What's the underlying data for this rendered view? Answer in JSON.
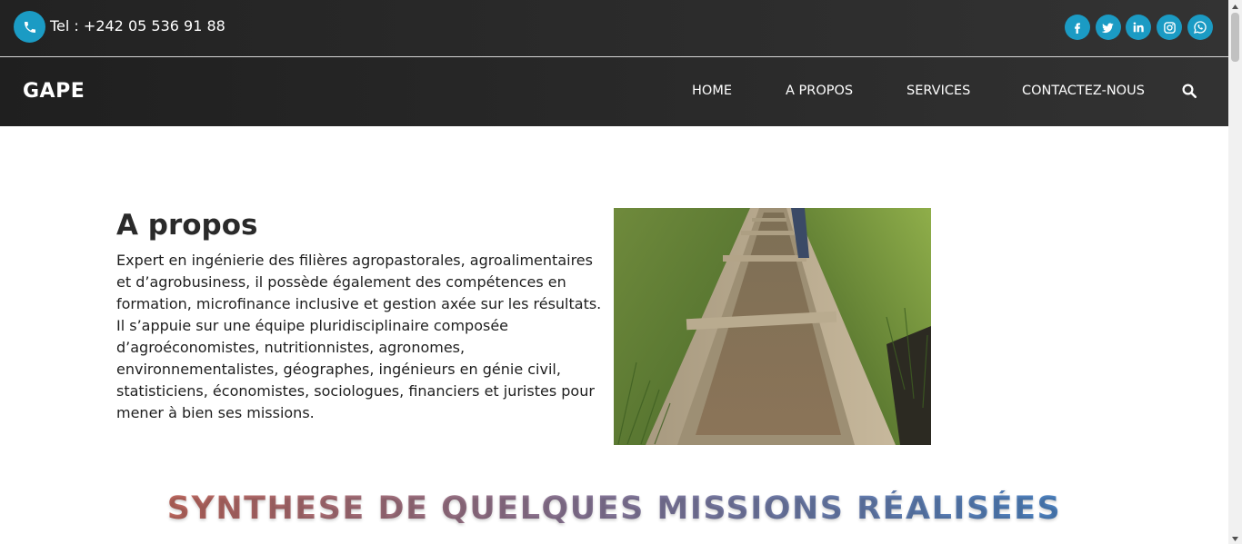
{
  "topbar": {
    "phone_label": "Tel : +242 05 536 91 88",
    "phone_icon": "phone-icon",
    "accent_color": "#1b9bc4",
    "socials": [
      {
        "name": "facebook-icon",
        "glyph": "f"
      },
      {
        "name": "twitter-icon",
        "glyph": "twitter"
      },
      {
        "name": "linkedin-icon",
        "glyph": "in"
      },
      {
        "name": "instagram-icon",
        "glyph": "instagram"
      },
      {
        "name": "whatsapp-icon",
        "glyph": "whatsapp"
      }
    ]
  },
  "navbar": {
    "logo": "GAPE",
    "items": [
      {
        "label": "HOME"
      },
      {
        "label": "A PROPOS"
      },
      {
        "label": "SERVICES"
      },
      {
        "label": "CONTACTEZ-NOUS"
      }
    ],
    "search_icon": "search-icon"
  },
  "about": {
    "title": "A propos",
    "text": "Expert en ingénierie des filières agropastorales, agroalimentaires et d’agrobusiness, il possède également des compétences en formation, microfinance inclusive et gestion axée sur les résultats. Il s’appuie sur une équipe pluridisciplinaire composée d’agroéconomistes, nutritionnistes, agronomes, environnementalistes, géographes, ingénieurs en génie civil, statisticiens, économistes, sociologues, financiers et juristes pour mener à bien ses missions."
  },
  "section": {
    "title": "SYNTHESE DE QUELQUES MISSIONS RÉALISÉES"
  }
}
